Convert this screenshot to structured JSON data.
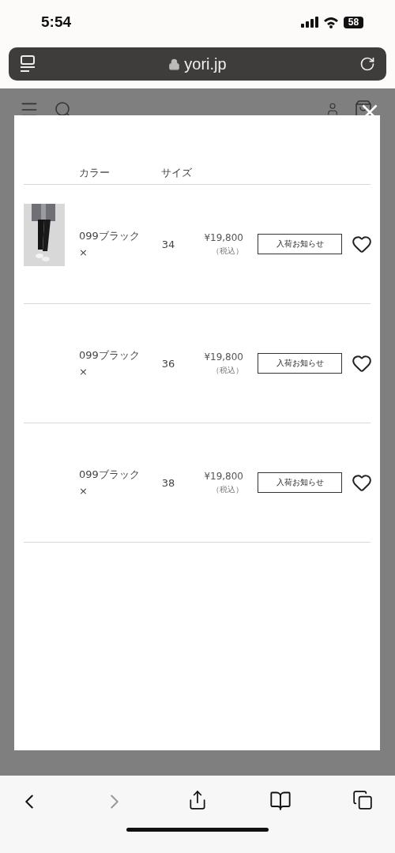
{
  "status_bar": {
    "time": "5:54",
    "battery": "58"
  },
  "address_bar": {
    "url": "yori.jp"
  },
  "modal": {
    "columns": [
      "カラー",
      "サイズ"
    ],
    "rows": [
      {
        "color_name": "099ブラック ×",
        "size": "34",
        "price": "¥19,800",
        "tax": "（税込）",
        "button": "入荷お知らせ",
        "favorite": false
      },
      {
        "color_name": "099ブラック ×",
        "size": "36",
        "price": "¥19,800",
        "tax": "（税込）",
        "button": "入荷お知らせ",
        "favorite": false
      },
      {
        "color_name": "099ブラック ×",
        "size": "38",
        "price": "¥19,800",
        "tax": "（税込）",
        "button": "入荷お知らせ",
        "favorite": false
      }
    ]
  },
  "toolbar": {
    "back": {
      "disabled": false
    },
    "forward": {
      "disabled": true
    }
  }
}
